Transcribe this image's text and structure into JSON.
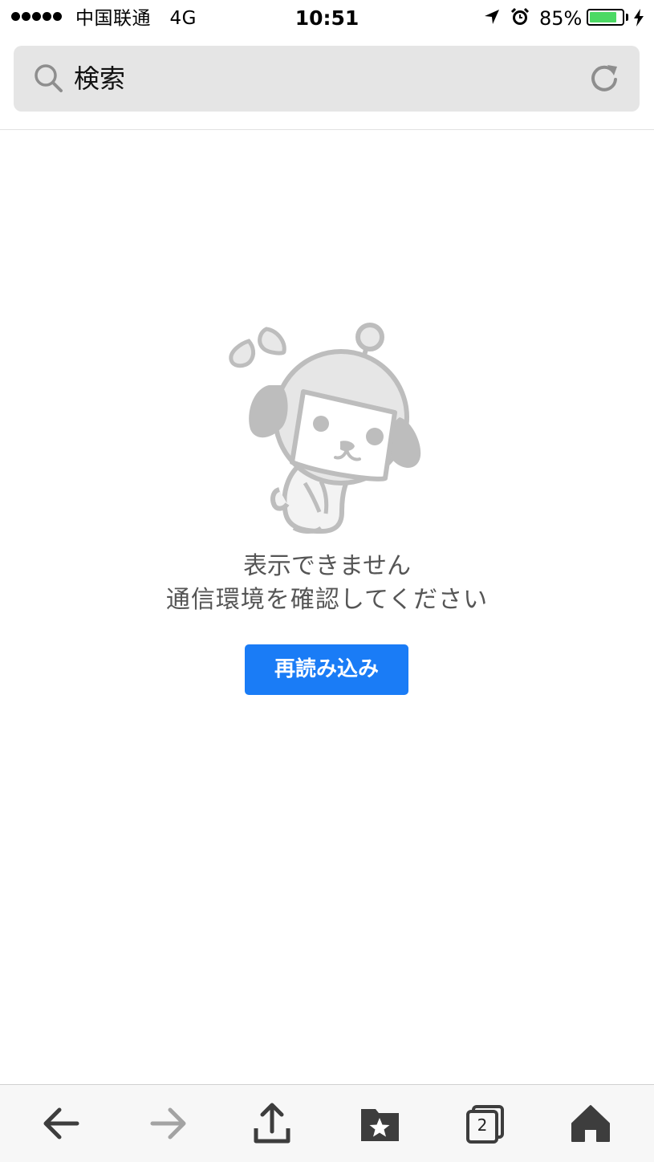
{
  "status_bar": {
    "signal_dots": 5,
    "carrier": "中国联通",
    "network": "4G",
    "time": "10:51",
    "battery_percent": "85%",
    "battery_level": 0.85,
    "battery_color": "#4cd964",
    "icons": [
      "location-arrow-icon",
      "alarm-clock-icon",
      "battery-icon",
      "charging-bolt-icon"
    ]
  },
  "search": {
    "placeholder": "検索",
    "icon": "search-icon",
    "reload_icon": "reload-icon"
  },
  "error": {
    "mascot": "confused-dog-mascot",
    "line1": "表示できません",
    "line2": "通信環境を確認してください",
    "reload_button_label": "再読み込み",
    "button_color": "#1a7cf6"
  },
  "toolbar": {
    "items": [
      {
        "name": "back",
        "icon": "back-arrow-icon",
        "enabled": true
      },
      {
        "name": "forward",
        "icon": "forward-arrow-icon",
        "enabled": false
      },
      {
        "name": "share",
        "icon": "share-icon",
        "enabled": true
      },
      {
        "name": "bookmarks",
        "icon": "bookmark-folder-star-icon",
        "enabled": true
      },
      {
        "name": "tabs",
        "icon": "tabs-icon",
        "enabled": true
      },
      {
        "name": "home",
        "icon": "home-icon",
        "enabled": true
      }
    ],
    "tab_count": "2"
  }
}
